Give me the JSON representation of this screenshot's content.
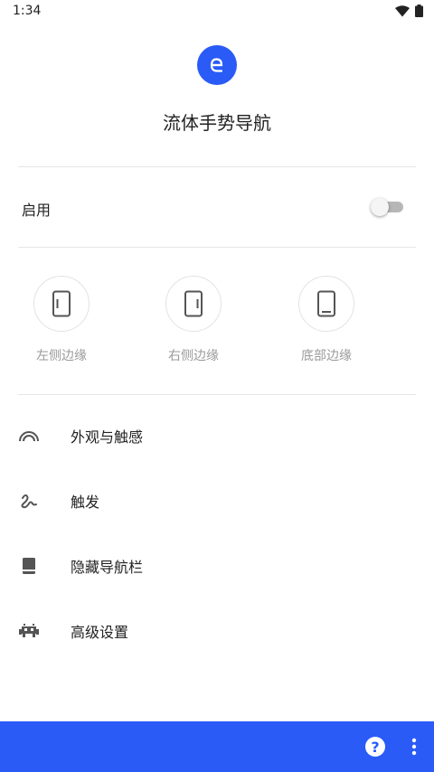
{
  "status": {
    "time": "1:34",
    "icons": [
      "wifi-icon",
      "battery-icon"
    ]
  },
  "app": {
    "title": "流体手势导航",
    "logo_icon": "gesture-logo-icon",
    "accent": "#2a5bf7"
  },
  "enable": {
    "label": "启用",
    "on": false
  },
  "edges": [
    {
      "label": "左侧边缘",
      "icon": "phone-left-edge-icon"
    },
    {
      "label": "右侧边缘",
      "icon": "phone-right-edge-icon"
    },
    {
      "label": "底部边缘",
      "icon": "phone-bottom-edge-icon"
    }
  ],
  "menu": [
    {
      "label": "外观与触感",
      "icon": "rainbow-icon"
    },
    {
      "label": "触发",
      "icon": "gesture-squiggle-icon"
    },
    {
      "label": "隐藏导航栏",
      "icon": "book-icon"
    },
    {
      "label": "高级设置",
      "icon": "space-invader-icon"
    }
  ],
  "bottom_bar": {
    "help_icon": "help-icon",
    "more_icon": "more-vert-icon",
    "help_glyph": "?"
  }
}
